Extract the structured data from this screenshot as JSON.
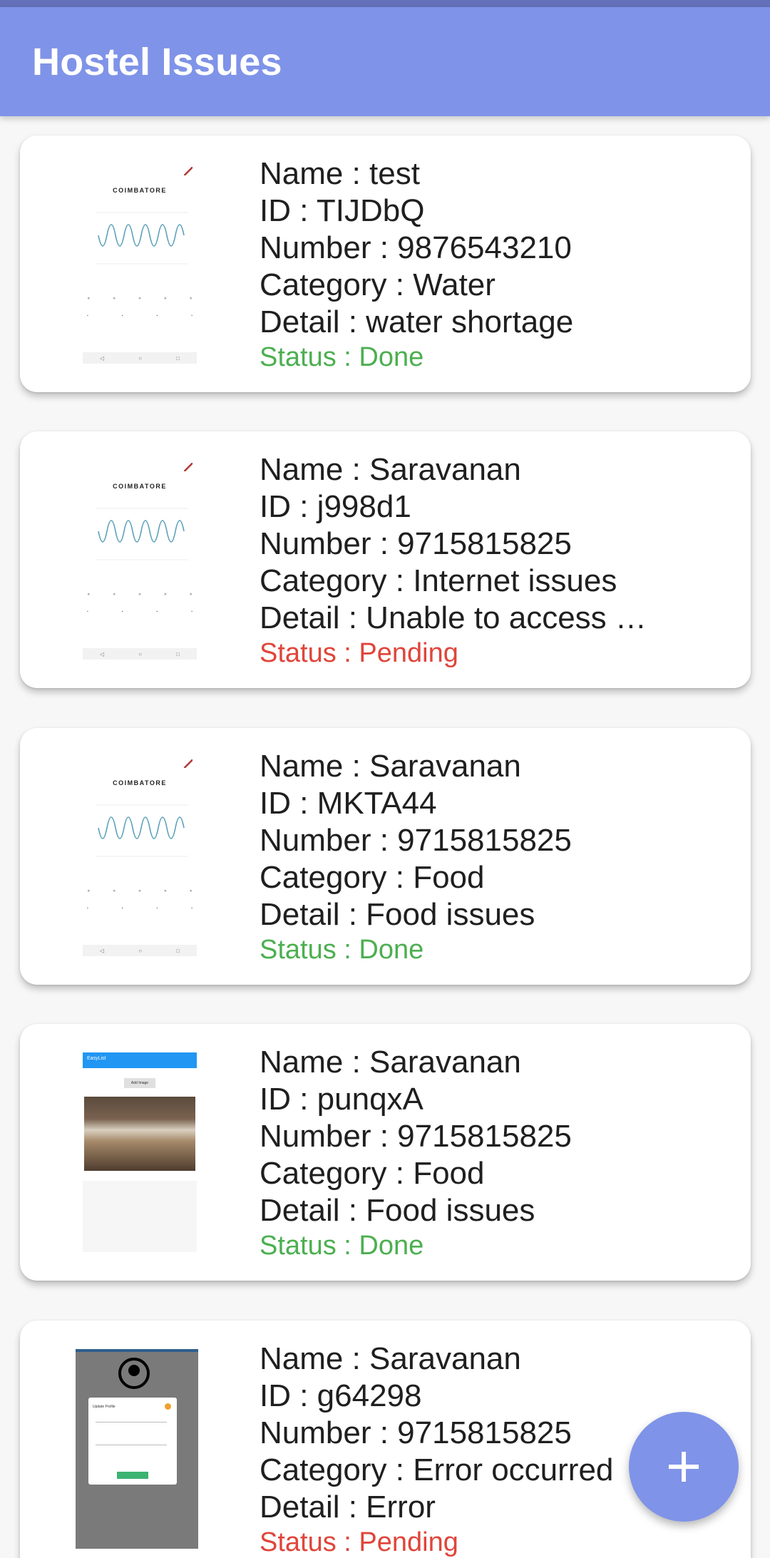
{
  "app": {
    "title": "Hostel Issues"
  },
  "issues": [
    {
      "thumb": "weather",
      "name": "Name : test",
      "id": "ID : TIJDbQ",
      "number": "Number : 9876543210",
      "category": "Category : Water",
      "detail": "Detail : water shortage",
      "status": "Status : Done",
      "status_type": "done"
    },
    {
      "thumb": "weather",
      "name": "Name : Saravanan",
      "id": "ID : j998d1",
      "number": "Number : 9715815825",
      "category": "Category : Internet issues",
      "detail": "Detail : Unable to access …",
      "status": "Status : Pending",
      "status_type": "pending"
    },
    {
      "thumb": "weather",
      "name": "Name : Saravanan",
      "id": "ID : MKTA44",
      "number": "Number : 9715815825",
      "category": "Category : Food",
      "detail": "Detail : Food issues",
      "status": "Status : Done",
      "status_type": "done"
    },
    {
      "thumb": "food",
      "name": "Name : Saravanan",
      "id": "ID : punqxA",
      "number": "Number : 9715815825",
      "category": "Category : Food",
      "detail": "Detail : Food issues",
      "status": "Status : Done",
      "status_type": "done"
    },
    {
      "thumb": "profile",
      "name": "Name : Saravanan",
      "id": "ID : g64298",
      "number": "Number : 9715815825",
      "category": "Category : Error occurred",
      "detail": "Detail : Error",
      "status": "Status : Pending",
      "status_type": "pending"
    }
  ],
  "thumbnails": {
    "weather": {
      "city": "COIMBATORE"
    },
    "food": {
      "bar_title": "EasyList",
      "button": "Add Image"
    },
    "profile": {
      "dialog_title": "Update Profile"
    }
  },
  "fab": {
    "icon": "plus-icon"
  },
  "colors": {
    "app_bar": "#7f93e8",
    "status_bar": "#6470b8",
    "status_done": "#4caf50",
    "status_pending": "#e0453a",
    "fab": "#7f93e8"
  }
}
